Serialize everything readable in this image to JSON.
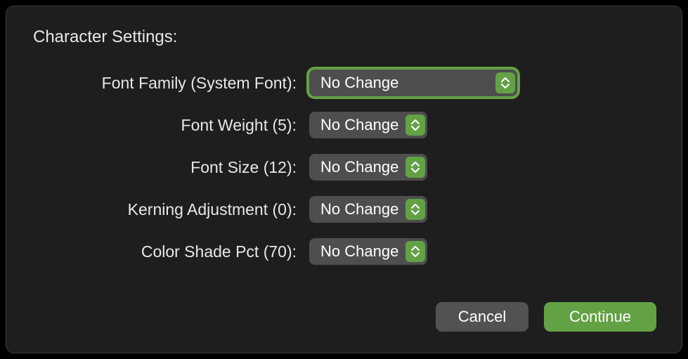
{
  "title": "Character Settings:",
  "fields": {
    "font_family": {
      "label": "Font Family (System Font):",
      "value": "No Change"
    },
    "font_weight": {
      "label": "Font Weight (5):",
      "value": "No Change"
    },
    "font_size": {
      "label": "Font Size (12):",
      "value": "No Change"
    },
    "kerning": {
      "label": "Kerning Adjustment (0):",
      "value": "No Change"
    },
    "color_shade": {
      "label": "Color Shade Pct (70):",
      "value": "No Change"
    }
  },
  "buttons": {
    "cancel": "Cancel",
    "continue": "Continue"
  },
  "colors": {
    "accent": "#63a145",
    "panel": "#1e1e1e",
    "control": "#4e4e4e",
    "secondary_button": "#525252"
  }
}
